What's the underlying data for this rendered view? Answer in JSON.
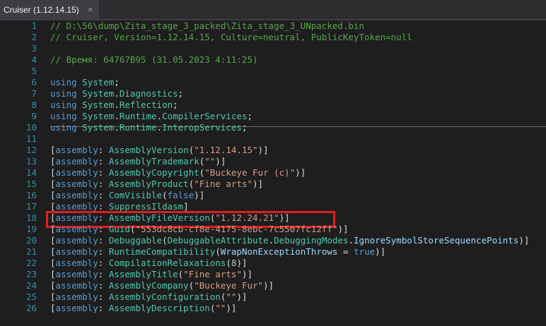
{
  "tab": {
    "title": "Cruiser (1.12.14.15)",
    "close": "×"
  },
  "lines": [
    {
      "n": "1",
      "tokens": [
        [
          "cm",
          "// D:\\56\\dump\\Zita_stage_3_packed\\Zita_stage_3_UNpacked.bin"
        ]
      ]
    },
    {
      "n": "2",
      "tokens": [
        [
          "cm",
          "// Cruiser, Version=1.12.14.15, Culture=neutral, PublicKeyToken=null"
        ]
      ]
    },
    {
      "n": "3",
      "tokens": []
    },
    {
      "n": "4",
      "tokens": [
        [
          "cm",
          "// Время: 64767B95 (31.05.2023 4:11:25)"
        ]
      ]
    },
    {
      "n": "5",
      "tokens": []
    },
    {
      "n": "6",
      "tokens": [
        [
          "kw",
          "using"
        ],
        [
          "tx",
          " "
        ],
        [
          "ty",
          "System"
        ],
        [
          "tx",
          ";"
        ]
      ]
    },
    {
      "n": "7",
      "tokens": [
        [
          "kw",
          "using"
        ],
        [
          "tx",
          " "
        ],
        [
          "ty",
          "System"
        ],
        [
          "tx",
          "."
        ],
        [
          "ty",
          "Diagnostics"
        ],
        [
          "tx",
          ";"
        ]
      ]
    },
    {
      "n": "8",
      "tokens": [
        [
          "kw",
          "using"
        ],
        [
          "tx",
          " "
        ],
        [
          "ty",
          "System"
        ],
        [
          "tx",
          "."
        ],
        [
          "ty",
          "Reflection"
        ],
        [
          "tx",
          ";"
        ]
      ]
    },
    {
      "n": "9",
      "tokens": [
        [
          "kw",
          "using"
        ],
        [
          "tx",
          " "
        ],
        [
          "ty",
          "System"
        ],
        [
          "tx",
          "."
        ],
        [
          "ty",
          "Runtime"
        ],
        [
          "tx",
          "."
        ],
        [
          "ty",
          "CompilerServices"
        ],
        [
          "tx",
          ";"
        ]
      ]
    },
    {
      "n": "10",
      "tokens": [
        [
          "kw",
          "using"
        ],
        [
          "tx",
          " "
        ],
        [
          "ty",
          "System"
        ],
        [
          "tx",
          "."
        ],
        [
          "ty",
          "Runtime"
        ],
        [
          "tx",
          "."
        ],
        [
          "ty",
          "InteropServices"
        ],
        [
          "tx",
          ";"
        ]
      ]
    },
    {
      "n": "11",
      "tokens": []
    },
    {
      "n": "12",
      "tokens": [
        [
          "tx",
          "["
        ],
        [
          "kw",
          "assembly"
        ],
        [
          "tx",
          ": "
        ],
        [
          "ty",
          "AssemblyVersion"
        ],
        [
          "tx",
          "("
        ],
        [
          "st",
          "\"1.12.14.15\""
        ],
        [
          "tx",
          ")]"
        ]
      ]
    },
    {
      "n": "13",
      "tokens": [
        [
          "tx",
          "["
        ],
        [
          "kw",
          "assembly"
        ],
        [
          "tx",
          ": "
        ],
        [
          "ty",
          "AssemblyTrademark"
        ],
        [
          "tx",
          "("
        ],
        [
          "st",
          "\"\""
        ],
        [
          "tx",
          ")]"
        ]
      ]
    },
    {
      "n": "14",
      "tokens": [
        [
          "tx",
          "["
        ],
        [
          "kw",
          "assembly"
        ],
        [
          "tx",
          ": "
        ],
        [
          "ty",
          "AssemblyCopyright"
        ],
        [
          "tx",
          "("
        ],
        [
          "st",
          "\"Buckeye Fur (c)\""
        ],
        [
          "tx",
          ")]"
        ]
      ]
    },
    {
      "n": "15",
      "tokens": [
        [
          "tx",
          "["
        ],
        [
          "kw",
          "assembly"
        ],
        [
          "tx",
          ": "
        ],
        [
          "ty",
          "AssemblyProduct"
        ],
        [
          "tx",
          "("
        ],
        [
          "st",
          "\"Fine arts\""
        ],
        [
          "tx",
          ")]"
        ]
      ]
    },
    {
      "n": "16",
      "tokens": [
        [
          "tx",
          "["
        ],
        [
          "kw",
          "assembly"
        ],
        [
          "tx",
          ": "
        ],
        [
          "ty",
          "ComVisible"
        ],
        [
          "tx",
          "("
        ],
        [
          "kw",
          "false"
        ],
        [
          "tx",
          ")]"
        ]
      ]
    },
    {
      "n": "17",
      "tokens": [
        [
          "tx",
          "["
        ],
        [
          "kw",
          "assembly"
        ],
        [
          "tx",
          ": "
        ],
        [
          "ty",
          "SuppressIldasm"
        ],
        [
          "tx",
          "]"
        ]
      ]
    },
    {
      "n": "18",
      "tokens": [
        [
          "tx",
          "["
        ],
        [
          "kw",
          "assembly"
        ],
        [
          "tx",
          ": "
        ],
        [
          "ty",
          "AssemblyFileVersion"
        ],
        [
          "tx",
          "("
        ],
        [
          "st",
          "\"1.12.24.21\""
        ],
        [
          "tx",
          ")]"
        ]
      ]
    },
    {
      "n": "19",
      "tokens": [
        [
          "tx",
          "["
        ],
        [
          "kw",
          "assembly"
        ],
        [
          "tx",
          ": "
        ],
        [
          "ty",
          "Guid"
        ],
        [
          "tx",
          "("
        ],
        [
          "st",
          "\"553dc8cb-cf8e-4175-8ebc-7c5507fc12ff\""
        ],
        [
          "tx",
          ")]"
        ]
      ]
    },
    {
      "n": "20",
      "tokens": [
        [
          "tx",
          "["
        ],
        [
          "kw",
          "assembly"
        ],
        [
          "tx",
          ": "
        ],
        [
          "ty",
          "Debuggable"
        ],
        [
          "tx",
          "("
        ],
        [
          "ty",
          "DebuggableAttribute"
        ],
        [
          "tx",
          "."
        ],
        [
          "ty",
          "DebuggingModes"
        ],
        [
          "tx",
          "."
        ],
        [
          "pm",
          "IgnoreSymbolStoreSequencePoints"
        ],
        [
          "tx",
          ")]"
        ]
      ]
    },
    {
      "n": "21",
      "tokens": [
        [
          "tx",
          "["
        ],
        [
          "kw",
          "assembly"
        ],
        [
          "tx",
          ": "
        ],
        [
          "ty",
          "RuntimeCompatibility"
        ],
        [
          "tx",
          "("
        ],
        [
          "pm",
          "WrapNonExceptionThrows"
        ],
        [
          "tx",
          " = "
        ],
        [
          "kw",
          "true"
        ],
        [
          "tx",
          ")]"
        ]
      ]
    },
    {
      "n": "22",
      "tokens": [
        [
          "tx",
          "["
        ],
        [
          "kw",
          "assembly"
        ],
        [
          "tx",
          ": "
        ],
        [
          "ty",
          "CompilationRelaxations"
        ],
        [
          "tx",
          "("
        ],
        [
          "nm",
          "8"
        ],
        [
          "tx",
          ")]"
        ]
      ]
    },
    {
      "n": "23",
      "tokens": [
        [
          "tx",
          "["
        ],
        [
          "kw",
          "assembly"
        ],
        [
          "tx",
          ": "
        ],
        [
          "ty",
          "AssemblyTitle"
        ],
        [
          "tx",
          "("
        ],
        [
          "st",
          "\"Fine arts\""
        ],
        [
          "tx",
          ")]"
        ]
      ]
    },
    {
      "n": "24",
      "tokens": [
        [
          "tx",
          "["
        ],
        [
          "kw",
          "assembly"
        ],
        [
          "tx",
          ": "
        ],
        [
          "ty",
          "AssemblyCompany"
        ],
        [
          "tx",
          "("
        ],
        [
          "st",
          "\"Buckeye Fur\""
        ],
        [
          "tx",
          ")]"
        ]
      ]
    },
    {
      "n": "25",
      "tokens": [
        [
          "tx",
          "["
        ],
        [
          "kw",
          "assembly"
        ],
        [
          "tx",
          ": "
        ],
        [
          "ty",
          "AssemblyConfiguration"
        ],
        [
          "tx",
          "("
        ],
        [
          "st",
          "\"\""
        ],
        [
          "tx",
          ")]"
        ]
      ]
    },
    {
      "n": "26",
      "tokens": [
        [
          "tx",
          "["
        ],
        [
          "kw",
          "assembly"
        ],
        [
          "tx",
          ": "
        ],
        [
          "ty",
          "AssemblyDescription"
        ],
        [
          "tx",
          "("
        ],
        [
          "st",
          "\"\""
        ],
        [
          "tx",
          ")]"
        ]
      ]
    }
  ],
  "colors": {
    "comment": "#57a64a",
    "keyword": "#569cd6",
    "type": "#4ec9b0",
    "string": "#d69d85",
    "number": "#b5cea8",
    "param": "#9cdcfe",
    "line_number": "#2b91af",
    "highlight_box": "#e41b23",
    "background": "#1e1e1e"
  }
}
